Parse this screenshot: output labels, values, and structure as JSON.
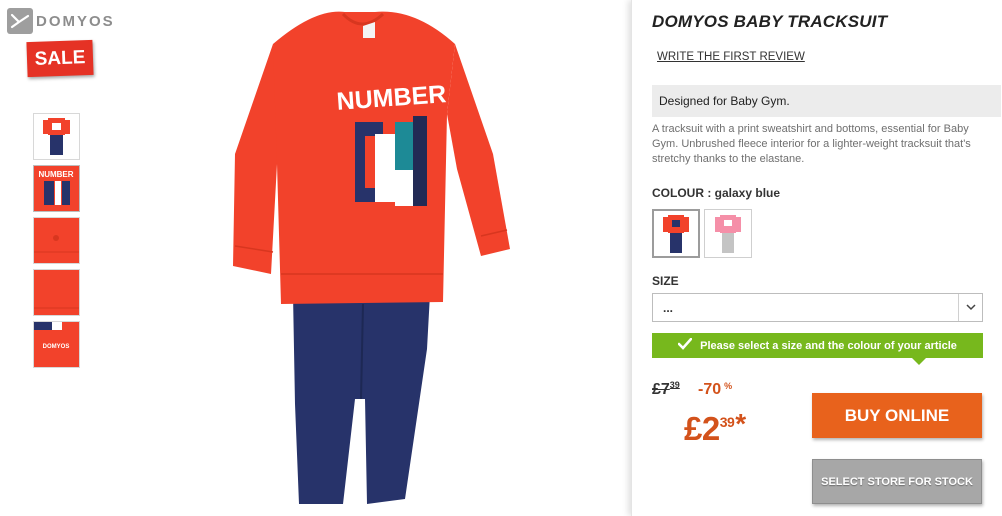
{
  "brand": {
    "name": "DOMYOS",
    "badge_icon": "domyos-logo-icon"
  },
  "sale_badge": "SALE",
  "thumbnails": [
    {
      "name": "thumb-full-outfit",
      "icon": "tracksuit-thumbnail"
    },
    {
      "name": "thumb-print-closeup",
      "icon": "print-closeup-thumbnail"
    },
    {
      "name": "thumb-button-closeup",
      "icon": "button-closeup-thumbnail"
    },
    {
      "name": "thumb-fabric-closeup",
      "icon": "fabric-closeup-thumbnail"
    },
    {
      "name": "thumb-logo-closeup",
      "icon": "logo-closeup-thumbnail",
      "text": "DOMYOS"
    }
  ],
  "product": {
    "title": "DOMYOS BABY TRACKSUIT",
    "review_link": "WRITE THE FIRST REVIEW",
    "tagline": "Designed for Baby Gym.",
    "description": "A tracksuit with a print sweatshirt and bottoms, essential for Baby Gym. Unbrushed fleece interior for a lighter-weight tracksuit that's stretchy thanks to the elastane.",
    "print_text": "NUMBER"
  },
  "colour": {
    "label": "COLOUR : ",
    "value": "galaxy blue",
    "swatches": [
      {
        "name": "red-navy",
        "selected": true
      },
      {
        "name": "pink-grey",
        "selected": false
      }
    ]
  },
  "size": {
    "label": "SIZE",
    "selected": "...",
    "caret_icon": "chevron-down-icon"
  },
  "alert": {
    "icon": "check-icon",
    "text": "Please select a size and the colour of your article"
  },
  "price": {
    "old_main": "£7",
    "old_pence": "39",
    "discount": "-70",
    "discount_unit": "%",
    "new_main": "£2",
    "new_pence": "39",
    "new_suffix": "*"
  },
  "buttons": {
    "buy": "BUY ONLINE",
    "store": "SELECT STORE FOR STOCK"
  },
  "colors": {
    "sale_red": "#e53225",
    "price_orange": "#d3521b",
    "buy_orange": "#e8621c",
    "alert_green": "#77b81d",
    "store_grey": "#a7a7a7",
    "sweatshirt_red": "#f2422b",
    "pants_navy": "#27336a"
  }
}
